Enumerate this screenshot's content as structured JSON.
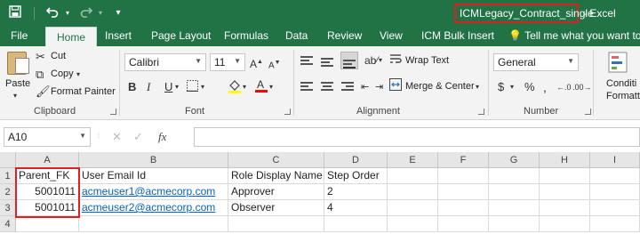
{
  "window": {
    "doc_title": "ICMLegacy_Contract_single",
    "app_title": "- Excel"
  },
  "tabs": [
    "File",
    "Home",
    "Insert",
    "Page Layout",
    "Formulas",
    "Data",
    "Review",
    "View",
    "ICM Bulk Insert"
  ],
  "tell_me": "Tell me what you want to do",
  "ribbon": {
    "clipboard": {
      "paste": "Paste",
      "cut": "Cut",
      "copy": "Copy",
      "format_painter": "Format Painter",
      "label": "Clipboard"
    },
    "font": {
      "name": "Calibri",
      "size": "11",
      "label": "Font"
    },
    "alignment": {
      "wrap_text": "Wrap Text",
      "merge_center": "Merge & Center",
      "label": "Alignment"
    },
    "number": {
      "format": "General",
      "label": "Number"
    },
    "styles": {
      "conditional_line1": "Conditi",
      "conditional_line2": "Formatti"
    }
  },
  "formula_bar": {
    "name_box": "A10",
    "fx": "fx",
    "content": ""
  },
  "sheet": {
    "columns": [
      "A",
      "B",
      "C",
      "D",
      "E",
      "F",
      "G",
      "H",
      "I"
    ],
    "rows": [
      {
        "num": "1",
        "cells": [
          "Parent_FK",
          "User Email Id",
          "Role Display Name",
          "Step Order"
        ]
      },
      {
        "num": "2",
        "cells": [
          "5001011",
          "acmeuser1@acmecorp.com",
          "Approver",
          "2"
        ]
      },
      {
        "num": "3",
        "cells": [
          "5001011",
          "acmeuser2@acmecorp.com",
          "Observer",
          "4"
        ]
      },
      {
        "num": "4",
        "cells": [
          "",
          "",
          "",
          ""
        ]
      }
    ]
  },
  "colors": {
    "excel_green": "#217346",
    "highlight_red": "#e02020",
    "link_blue": "#0563c1"
  }
}
